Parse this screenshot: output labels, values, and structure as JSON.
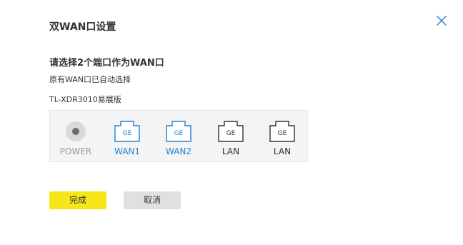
{
  "dialog": {
    "title": "双WAN口设置",
    "heading": "请选择2个端口作为WAN口",
    "subtext": "原有WAN口已自动选择",
    "model": "TL-XDR3010易展版"
  },
  "ports": [
    {
      "label": "POWER",
      "kind": "power",
      "state": "inactive"
    },
    {
      "label": "WAN1",
      "kind": "ethernet",
      "state": "selected",
      "glyph_text": "GE"
    },
    {
      "label": "WAN2",
      "kind": "ethernet",
      "state": "selected",
      "glyph_text": "GE"
    },
    {
      "label": "LAN",
      "kind": "ethernet",
      "state": "unselected",
      "glyph_text": "GE"
    },
    {
      "label": "LAN",
      "kind": "ethernet",
      "state": "unselected",
      "glyph_text": "GE"
    }
  ],
  "buttons": {
    "ok_label": "完成",
    "cancel_label": "取消"
  },
  "icons": {
    "close": "close-icon",
    "power": "power-indicator-icon",
    "ethernet": "ethernet-port-icon"
  },
  "colors": {
    "accent_blue": "#1e82d2",
    "ok_button": "#f7e718",
    "cancel_button": "#e0e0e0",
    "port_dark": "#333333",
    "power_grey": "#9a9a9a"
  }
}
